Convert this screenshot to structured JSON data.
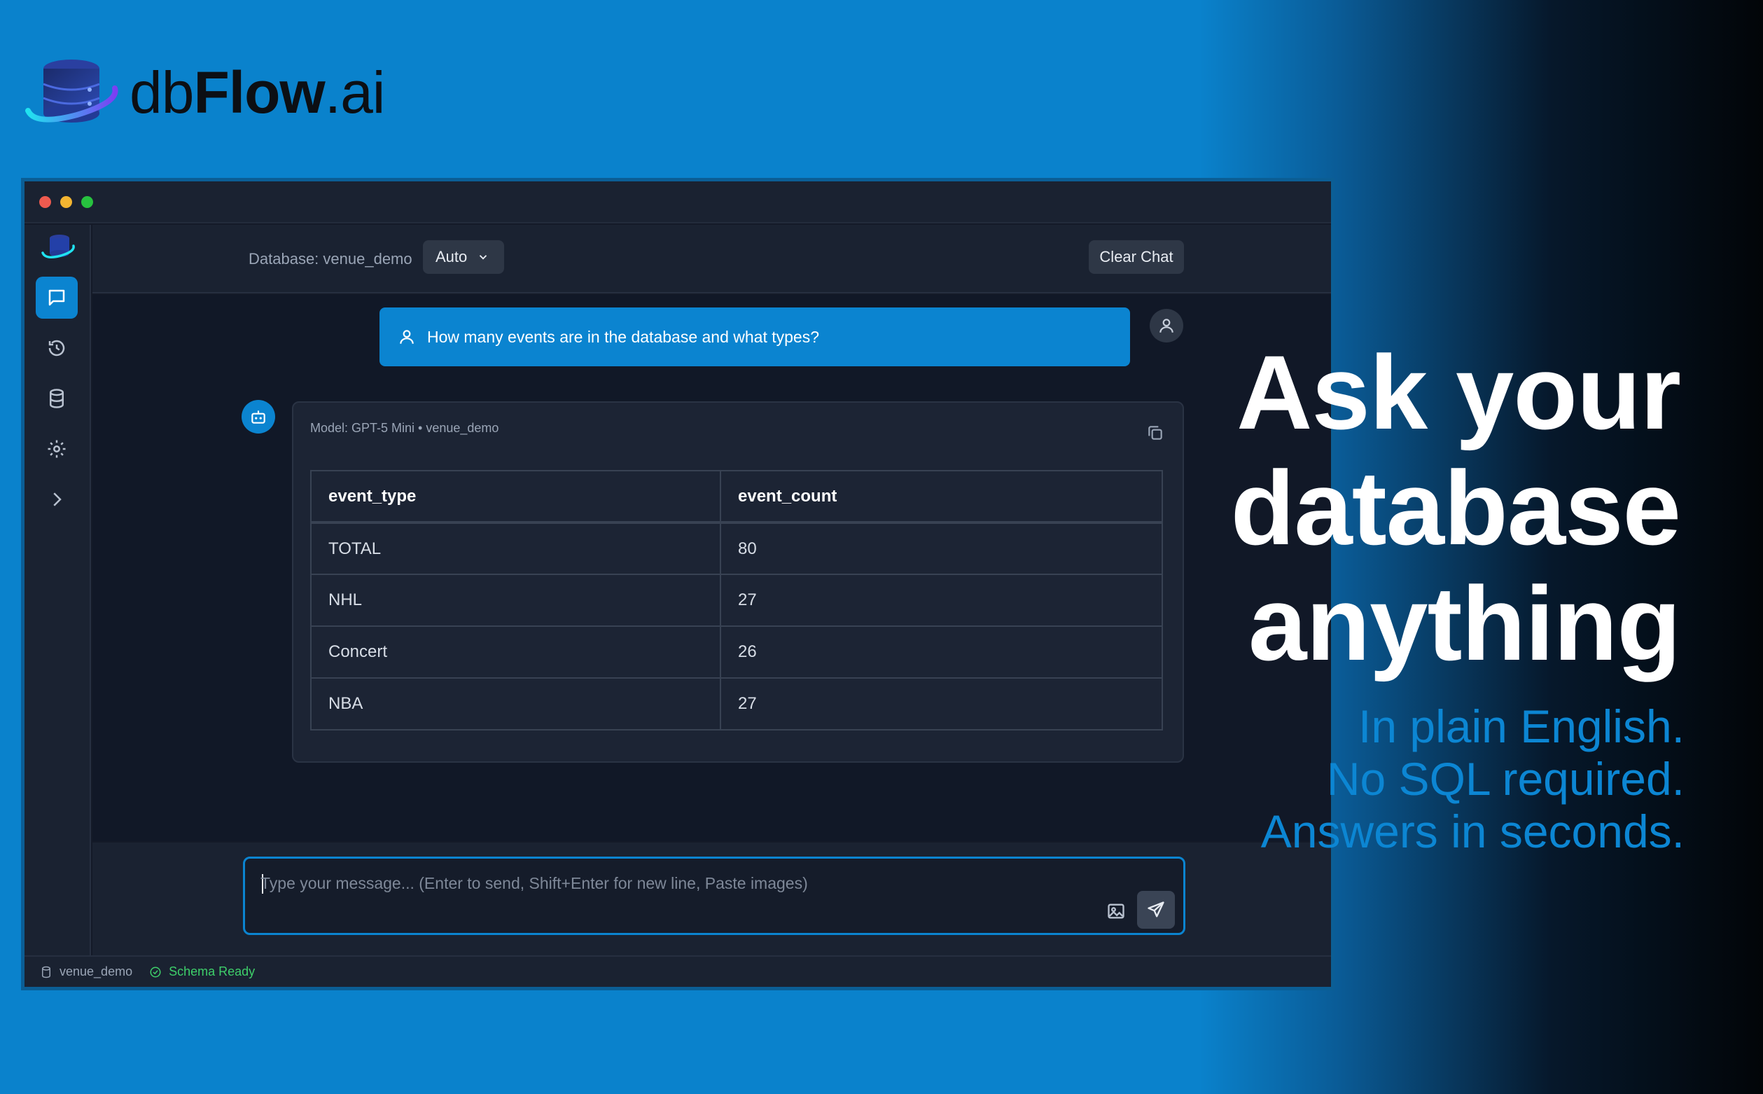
{
  "promo": {
    "logo_prefix": "db",
    "logo_bold": "Flow",
    "logo_suffix": ".ai",
    "headline": [
      "Ask your",
      "database",
      "anything"
    ],
    "sublines": [
      "In plain English.",
      "No SQL required.",
      "Answers in seconds."
    ]
  },
  "topbar": {
    "database_label": "Database: venue_demo",
    "model_selected": "Auto",
    "clear_chat_label": "Clear Chat"
  },
  "sidebar": {
    "items": [
      {
        "name": "chat",
        "icon": "chat-bubble-icon",
        "active": true
      },
      {
        "name": "history",
        "icon": "history-icon",
        "active": false
      },
      {
        "name": "database",
        "icon": "database-icon",
        "active": false
      },
      {
        "name": "settings",
        "icon": "gear-icon",
        "active": false
      },
      {
        "name": "expand",
        "icon": "chevron-right-icon",
        "active": false
      }
    ]
  },
  "chat": {
    "user_message": "How many events are in the database and what types?",
    "answer_meta": "Model: GPT-5 Mini • venue_demo",
    "table": {
      "columns": [
        "event_type",
        "event_count"
      ],
      "rows": [
        [
          "TOTAL",
          "80"
        ],
        [
          "NHL",
          "27"
        ],
        [
          "Concert",
          "26"
        ],
        [
          "NBA",
          "27"
        ]
      ]
    }
  },
  "input": {
    "placeholder": "Type your message... (Enter to send, Shift+Enter for new line, Paste images)",
    "value": ""
  },
  "status": {
    "database": "venue_demo",
    "schema": "Schema Ready"
  },
  "colors": {
    "accent": "#0b84d0",
    "success": "#3ecf6a",
    "window_bg": "#141a28"
  }
}
